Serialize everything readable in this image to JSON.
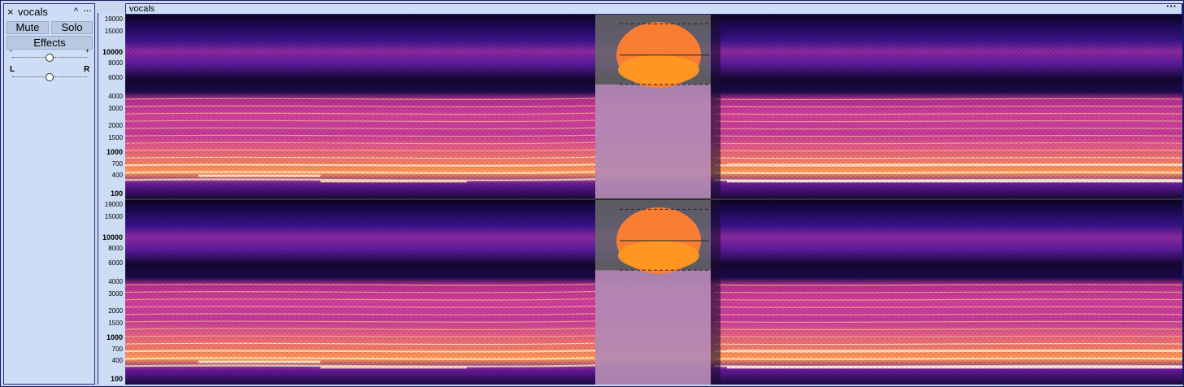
{
  "track": {
    "name": "vocals",
    "close_glyph": "×",
    "collapse_glyph": "^",
    "menu_glyph": "···",
    "mute_label": "Mute",
    "solo_label": "Solo",
    "effects_label": "Effects",
    "gain_minus": "−",
    "gain_plus": "+",
    "pan_left": "L",
    "pan_right": "R",
    "gain_level": 0.5,
    "pan_level": 0.5
  },
  "clip": {
    "name": "vocals",
    "menu_glyph": "···"
  },
  "ruler": {
    "channel_1": [
      "19000",
      "15000",
      "10000",
      "8000",
      "6000",
      "4000",
      "3000",
      "2000",
      "1500",
      "1000",
      "700",
      "400",
      "100"
    ],
    "channel_2": [
      "19000",
      "15000",
      "10000",
      "8000",
      "6000",
      "4000",
      "3000",
      "2000",
      "1500",
      "1000",
      "700",
      "400",
      "100"
    ]
  },
  "colors": {
    "panel_bg": "#cdddf5",
    "border": "#2b2b80",
    "selection_overlay": "#ffffff"
  },
  "icons": {
    "close": "close-icon",
    "collapse": "chevron-up-icon",
    "menu": "more-icon"
  }
}
